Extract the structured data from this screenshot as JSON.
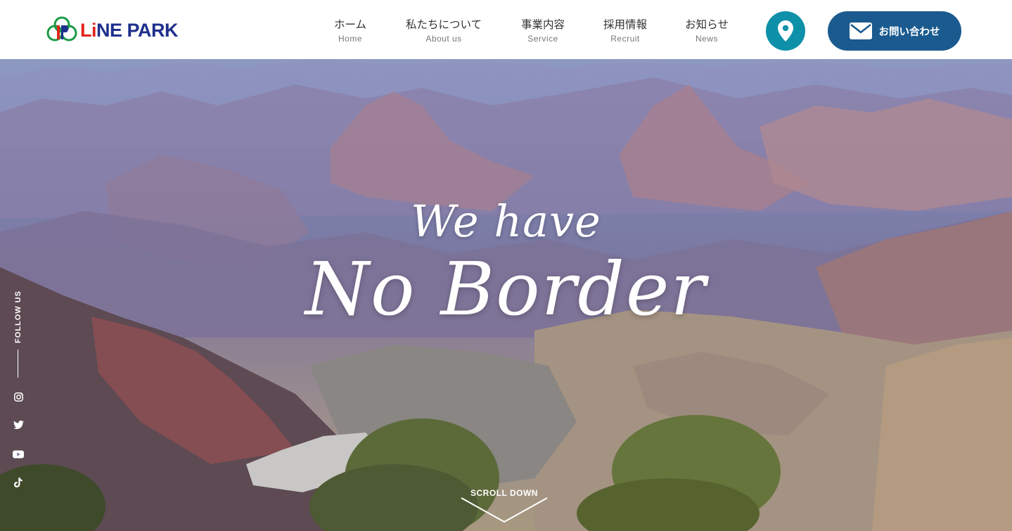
{
  "brand": {
    "logo_text_red": "Li",
    "logo_text_blue": "NE PARK",
    "colors": {
      "red": "#e2231a",
      "blue": "#1e2f8c",
      "green": "#1a9a44"
    }
  },
  "nav": {
    "items": [
      {
        "jp": "ホーム",
        "en": "Home"
      },
      {
        "jp": "私たちについて",
        "en": "About us"
      },
      {
        "jp": "事業内容",
        "en": "Service"
      },
      {
        "jp": "採用情報",
        "en": "Recruit"
      },
      {
        "jp": "お知らせ",
        "en": "News"
      }
    ],
    "map_icon": "map-pin-icon",
    "contact_label": "お問い合わせ",
    "contact_icon": "envelope-icon",
    "colors": {
      "map": "#0e90a8",
      "contact": "#1a5a8f"
    }
  },
  "hero": {
    "line1": "We have",
    "line2": "No Border"
  },
  "follow": {
    "label": "FOLLOW US",
    "icons": [
      "instagram-icon",
      "twitter-icon",
      "youtube-icon",
      "tiktok-icon"
    ]
  },
  "scroll": {
    "label": "SCROLL DOWN"
  }
}
